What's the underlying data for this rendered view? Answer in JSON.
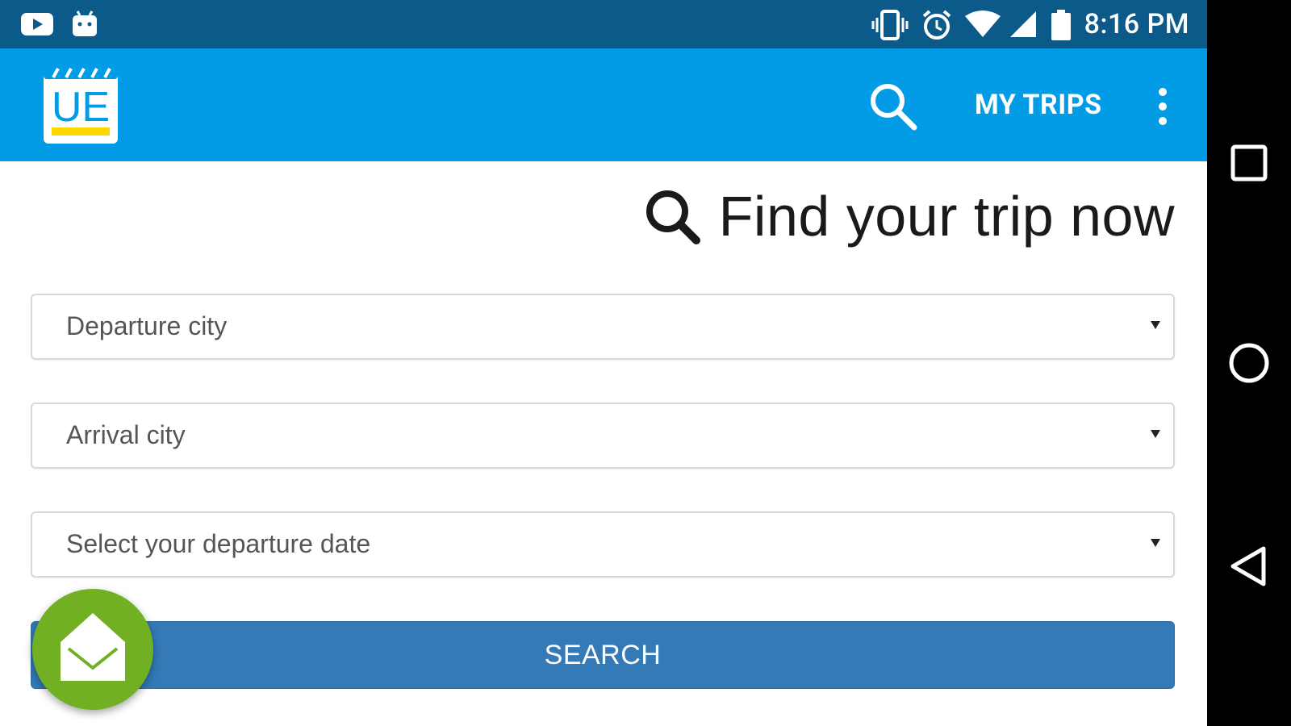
{
  "status_bar": {
    "time": "8:16 PM",
    "icons": [
      "youtube-icon",
      "android-icon",
      "vibrate-icon",
      "alarm-icon",
      "wifi-icon",
      "signal-icon",
      "battery-icon"
    ]
  },
  "app_bar": {
    "logo_text": "UE",
    "my_trips_label": "MY TRIPS",
    "background_color": "#029be5"
  },
  "main": {
    "heading": "Find your trip now",
    "departure_placeholder": "Departure city",
    "arrival_placeholder": "Arrival city",
    "date_placeholder": "Select your departure date",
    "search_label": "SEARCH",
    "search_button_color": "#337ab7",
    "fab_color": "#72b023"
  },
  "nav_bar": {
    "buttons": [
      "recents-icon",
      "home-icon",
      "back-icon"
    ]
  }
}
